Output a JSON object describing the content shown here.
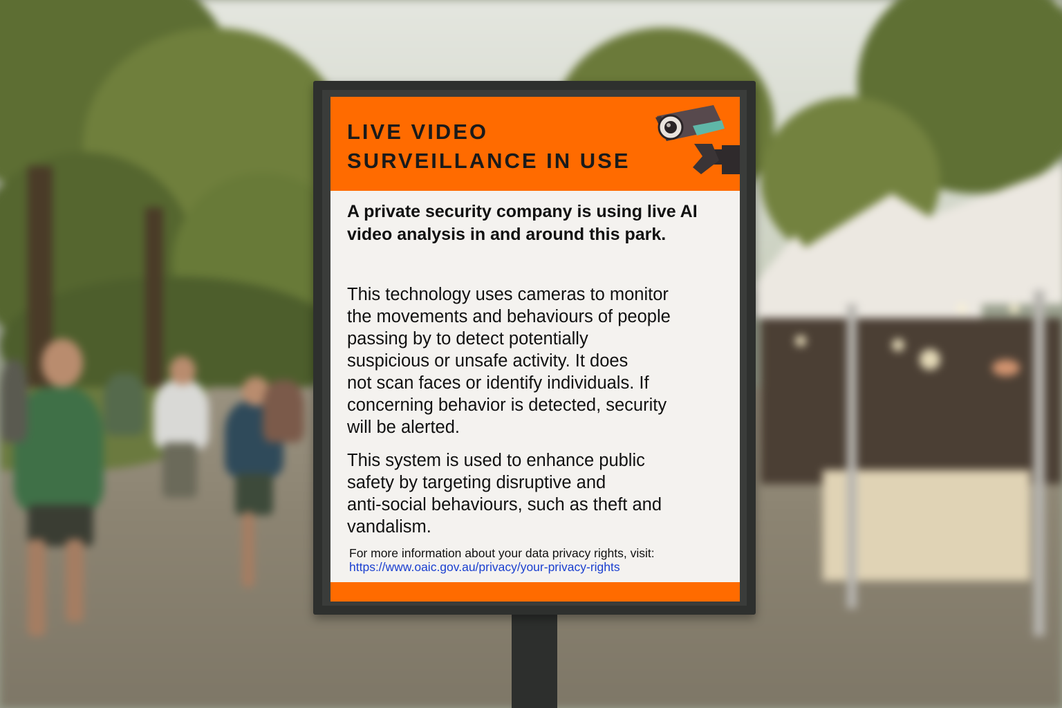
{
  "sign": {
    "title_line1": "LIVE VIDEO",
    "title_line2": "SURVEILLANCE IN USE",
    "icon": "cctv-camera-icon",
    "lead": "A private security company is using live AI video analysis in and around this park.",
    "paragraph1_lines": [
      "This technology uses cameras to monitor",
      "the movements and behaviours of people",
      "passing by to detect potentially",
      "suspicious or unsafe activity. It does",
      "not scan faces or identify individuals. If",
      "concerning behavior is detected, security",
      "will be alerted."
    ],
    "paragraph2_lines": [
      "This system is used to enhance public",
      "safety by targeting disruptive and",
      "anti-social behaviours, such as theft and",
      "vandalism."
    ],
    "info_text": "For more information about your data privacy rights, visit:",
    "info_link": "https://www.oaic.gov.au/privacy/your-privacy-rights"
  },
  "colors": {
    "accent_orange": "#ff6b00",
    "link_blue": "#1a3fd0",
    "frame": "#2e302e"
  }
}
